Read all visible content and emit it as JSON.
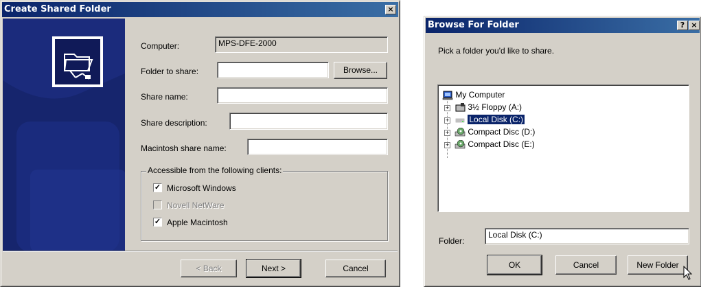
{
  "create_dialog": {
    "title": "Create Shared Folder",
    "close_glyph": "×",
    "computer_label": "Computer:",
    "computer_value": "MPS-DFE-2000",
    "folder_label": "Folder to share:",
    "folder_value": "",
    "browse_label": "Browse...",
    "share_name_label": "Share name:",
    "share_name_value": "",
    "share_desc_label": "Share description:",
    "share_desc_value": "",
    "mac_share_label": "Macintosh share name:",
    "mac_share_value": "",
    "clients_group_label": "Accessible from the following clients:",
    "clients": [
      {
        "label": "Microsoft Windows",
        "checked": true,
        "enabled": true
      },
      {
        "label": "Novell NetWare",
        "checked": false,
        "enabled": false
      },
      {
        "label": "Apple Macintosh",
        "checked": true,
        "enabled": true
      }
    ],
    "back_label": "< Back",
    "next_label": "Next >",
    "cancel_label": "Cancel"
  },
  "browse_dialog": {
    "title": "Browse For Folder",
    "help_glyph": "?",
    "close_glyph": "×",
    "prompt": "Pick a folder you'd like to share.",
    "tree": {
      "root": "My Computer",
      "items": [
        {
          "label": "3½ Floppy (A:)",
          "icon": "floppy-drive-icon",
          "selected": false
        },
        {
          "label": "Local Disk (C:)",
          "icon": "hard-disk-icon",
          "selected": true
        },
        {
          "label": "Compact Disc (D:)",
          "icon": "cd-drive-icon",
          "selected": false
        },
        {
          "label": "Compact Disc (E:)",
          "icon": "cd-drive-icon",
          "selected": false
        }
      ]
    },
    "folder_label": "Folder:",
    "folder_value": "Local Disk (C:)",
    "ok_label": "OK",
    "cancel_label": "Cancel",
    "new_folder_label": "New Folder"
  },
  "colors": {
    "title_start": "#0a246a",
    "title_end": "#3a6ea5",
    "dialog_face": "#d4d0c8",
    "wizard_panel": "#1a2a78",
    "selection": "#0a246a"
  }
}
